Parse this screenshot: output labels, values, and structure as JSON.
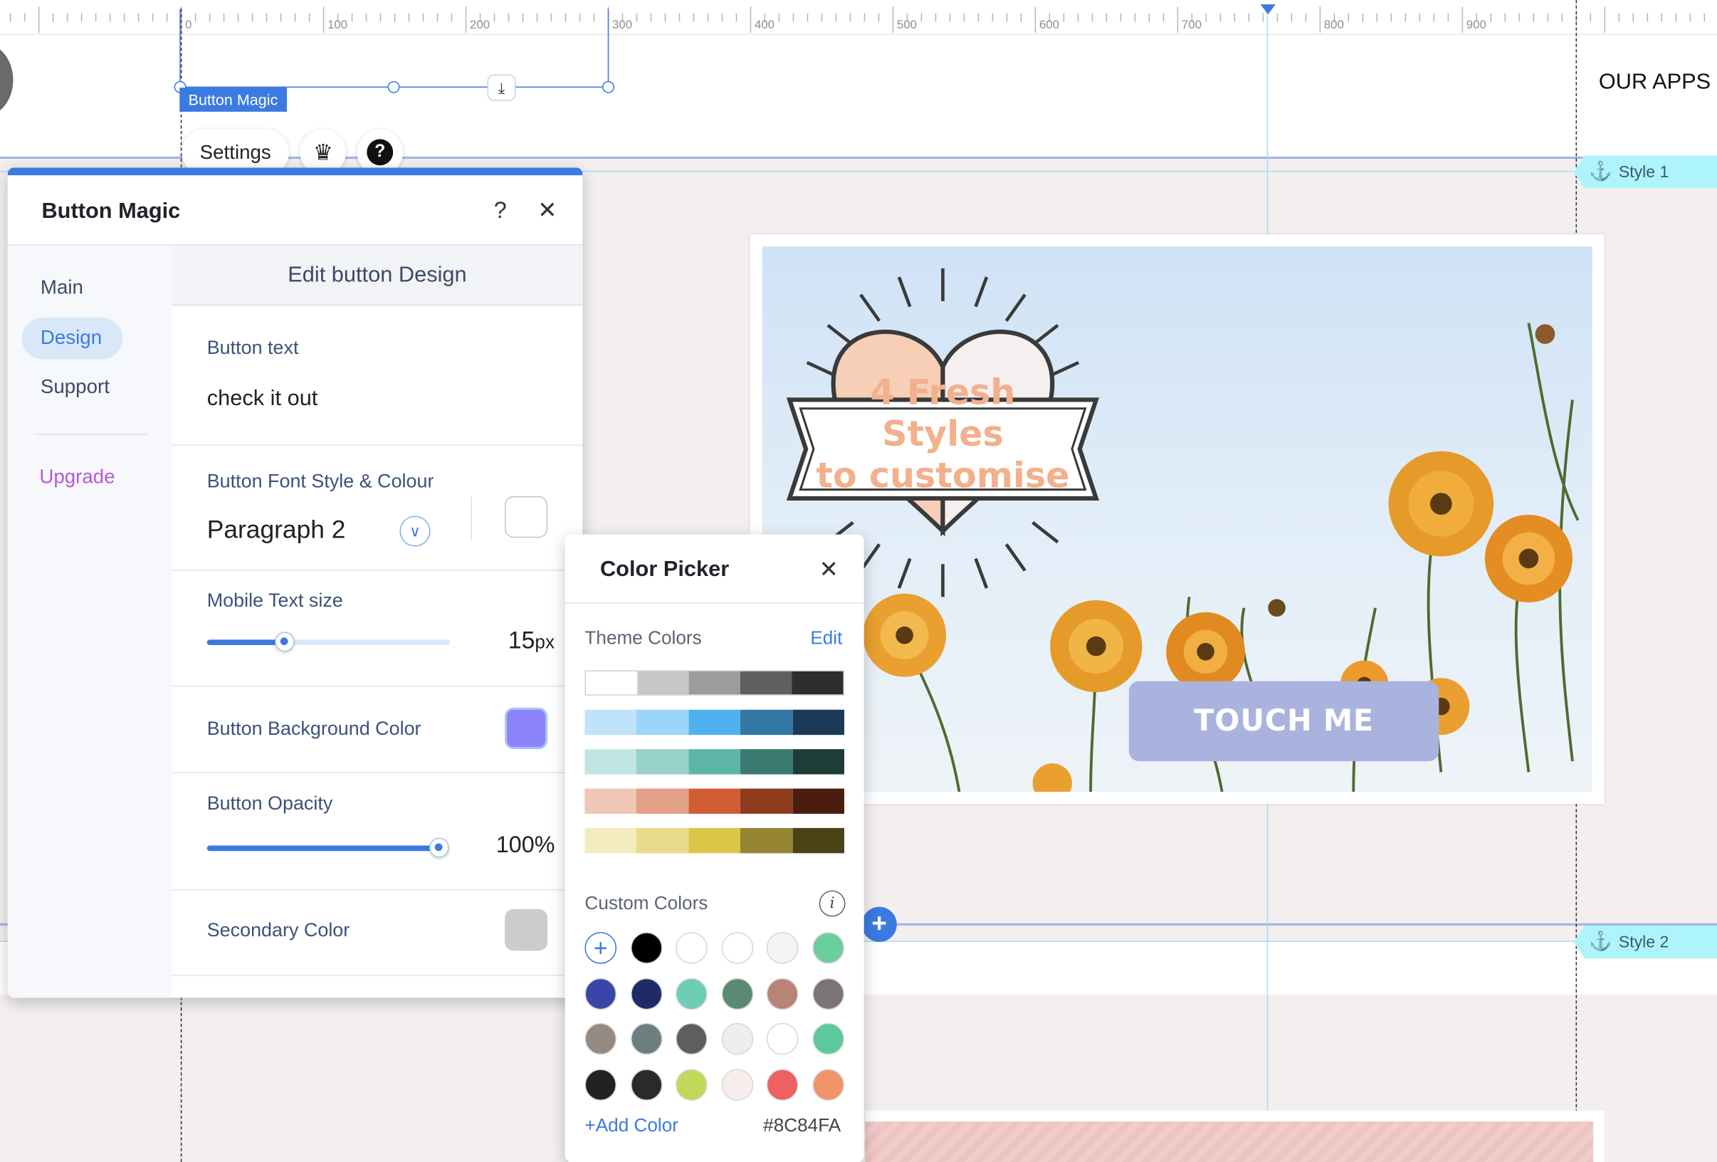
{
  "ruler": {
    "labels": [
      "0",
      "100",
      "200",
      "300",
      "400",
      "500",
      "600",
      "700",
      "800",
      "900"
    ]
  },
  "canvas": {
    "selected_label": "Button Magic",
    "settings_label": "Settings",
    "our_apps": "OUR APPS",
    "anchor_1": "Style 1",
    "anchor_2": "Style 2",
    "hero_line1": "4 Fresh Styles",
    "hero_line2": "to customise",
    "button_text": "TOUCH ME"
  },
  "panel": {
    "title": "Button Magic",
    "help": "?",
    "close": "✕",
    "nav": [
      "Main",
      "Design",
      "Support",
      "Upgrade"
    ],
    "section_title": "Edit button Design",
    "button_text_label": "Button text",
    "button_text_value": "check it out",
    "font_label": "Button Font Style & Colour",
    "font_value": "Paragraph 2",
    "mobile_label": "Mobile Text size",
    "mobile_value": "15",
    "mobile_unit": "px",
    "mobile_fraction": 0.32,
    "bg_label": "Button Background Color",
    "bg_color": "#8C84FA",
    "opacity_label": "Button Opacity",
    "opacity_value": "100%",
    "opacity_fraction": 1.0,
    "secondary_label": "Secondary Color",
    "secondary_color": "#cccccc"
  },
  "picker": {
    "title": "Color Picker",
    "close": "✕",
    "theme_label": "Theme Colors",
    "edit": "Edit",
    "theme_rows": [
      [
        "#ffffff",
        "#c8c8c8",
        "#9c9c9c",
        "#5f5f5f",
        "#2e2e2e"
      ],
      [
        "#bfe3fb",
        "#9dd5f8",
        "#4fb2ef",
        "#3377a4",
        "#1c3a56"
      ],
      [
        "#c1e6e2",
        "#98d1c9",
        "#5db5a8",
        "#3a7a70",
        "#1f3d38"
      ],
      [
        "#f0c6b4",
        "#e3a088",
        "#d25d35",
        "#8e3b1e",
        "#4a1d10"
      ],
      [
        "#f4ecbf",
        "#e8dc8a",
        "#dbc648",
        "#958533",
        "#4b4318"
      ]
    ],
    "custom_label": "Custom Colors",
    "custom_colors": [
      [
        "add",
        "#000000",
        "#ffffff",
        "#ffffff",
        "#f4f4f4",
        "#6ccd9f"
      ],
      [
        "#3b45a8",
        "#1f2a68",
        "#6dcdb5",
        "#5a8a72",
        "#b88478",
        "#7c7378"
      ],
      [
        "#948a82",
        "#6d7e80",
        "#5e5e5e",
        "#eeeeee",
        "#ffffff",
        "#5cc99d"
      ],
      [
        "#222222",
        "#2a2a2a",
        "#c0d95a",
        "#f8eded",
        "#ef6060",
        "#f1946a"
      ]
    ],
    "add_color": "+Add Color",
    "hex": "#8C84FA"
  }
}
